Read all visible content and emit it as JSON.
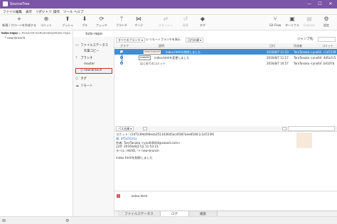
{
  "window": {
    "title": "SourceTree",
    "minimize": "—",
    "maximize": "☐",
    "close": "✕"
  },
  "menu": [
    "ファイル",
    "編集",
    "表示",
    "リポジトリ",
    "操作",
    "ツール",
    "ヘルプ"
  ],
  "toolbar": {
    "left": [
      {
        "icon": "+",
        "label": "新規 / クローンを作成する",
        "disabled": false
      },
      {
        "icon": "⊕",
        "label": "コミット",
        "disabled": false
      },
      {
        "icon": "⬆",
        "label": "プッシュ",
        "disabled": false
      },
      {
        "icon": "⬇",
        "label": "プル",
        "disabled": false
      },
      {
        "icon": "⟳",
        "label": "フェッチ",
        "disabled": false
      },
      {
        "icon": "ᛘ",
        "label": "ブランチ",
        "disabled": false
      },
      {
        "icon": "⋈",
        "label": "マージ",
        "disabled": false
      },
      {
        "icon": "⇄",
        "label": "スタッシュ",
        "disabled": true
      },
      {
        "icon": "↺",
        "label": "破棄",
        "disabled": true
      },
      {
        "icon": "◆",
        "label": "タグ",
        "disabled": false
      }
    ],
    "right": [
      {
        "icon": "⑂",
        "label": "Git Flow",
        "disabled": false
      },
      {
        "icon": "▣",
        "label": "ターミナル",
        "disabled": false
      },
      {
        "icon": "▤",
        "label": "Explorer",
        "disabled": true
      },
      {
        "icon": "⚙",
        "label": "設定",
        "disabled": false
      }
    ]
  },
  "repo": {
    "name": "tuto-repo",
    "path": "C:¥Users¥Tks¥Desktop¥tuto-repo",
    "branch": "new-branch",
    "tab": "tuto-repo"
  },
  "sidebar": {
    "workspace_items": [
      "ファイルステータス",
      "作業コピー"
    ],
    "branches_header": "ブランチ",
    "branches": [
      "master",
      "new-branch"
    ],
    "tags_header": "タグ",
    "remotes_header": "リモート"
  },
  "jump_label": "ジャンプ先:",
  "filter": {
    "branches": "すべてのブランチ",
    "show_remote": "リモートブランチを表示",
    "order": "日付の順"
  },
  "columns": {
    "graph": "グラフ",
    "description": "説明",
    "date": "日付",
    "author": "作成者",
    "commit": "コミット"
  },
  "commits": [
    {
      "tags": [
        "new-branch"
      ],
      "description": "index.htmlを削除しました",
      "date": "2016/8/7 11:53",
      "author": "TaroTanaka <yno64",
      "hash": "c1d7239",
      "selected": true
    },
    {
      "tags": [
        "master"
      ],
      "description": "index.htmlを変更しました",
      "date": "2016/8/7 11:17",
      "author": "TaroTanaka <yno64",
      "hash": "4d5a7c5",
      "selected": false
    },
    {
      "tags": [],
      "description": "はじめてのコミット",
      "date": "2016/8/7 10:57",
      "author": "TaroTanaka <yno64",
      "hash": "b4107b",
      "selected": false
    }
  ],
  "detail": {
    "sort_label": "パス名順",
    "commit_line": "コミット: c1d7239d494ecb2513436d5acdf387aee0548 [c1d7239]",
    "parent_line": "親: 4f5a5624a",
    "author_line": "作者: TaroTanaka <yno64844@zaood.com>",
    "date_line": "日付: 2016年8月7日 11:53:21",
    "labels_line": "ラベル: HEAD, -> new-branch",
    "message": "index.htmlを削除しました"
  },
  "files": [
    "index.html"
  ],
  "bottom_tabs": [
    "ファイルステータス",
    "ログ",
    "検索"
  ],
  "active_bottom_tab": "ログ",
  "accent": "#7b55a6",
  "selection": "#3b8fd6",
  "highlight_border": "#d32f2f"
}
